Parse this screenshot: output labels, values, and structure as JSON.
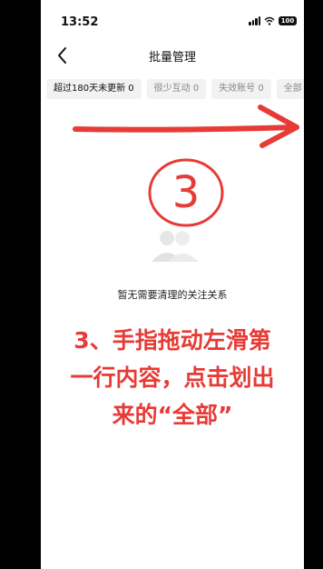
{
  "status_bar": {
    "time": "13:52",
    "battery": "100"
  },
  "nav": {
    "title": "批量管理"
  },
  "tabs": [
    {
      "label": "超过180天未更新 0",
      "active": true
    },
    {
      "label": "很少互动 0",
      "active": false
    },
    {
      "label": "失效账号 0",
      "active": false
    },
    {
      "label": "全部",
      "active": false
    }
  ],
  "annotation": {
    "circle_number": "3"
  },
  "empty_state": {
    "text": "暂无需要清理的关注关系"
  },
  "instruction": {
    "line1": "3、手指拖动左滑第",
    "line2": "一行内容，点击划出",
    "line3": "来的“全部”"
  },
  "colors": {
    "accent_red": "#e63b36",
    "tab_bg": "#f2f2f2"
  }
}
